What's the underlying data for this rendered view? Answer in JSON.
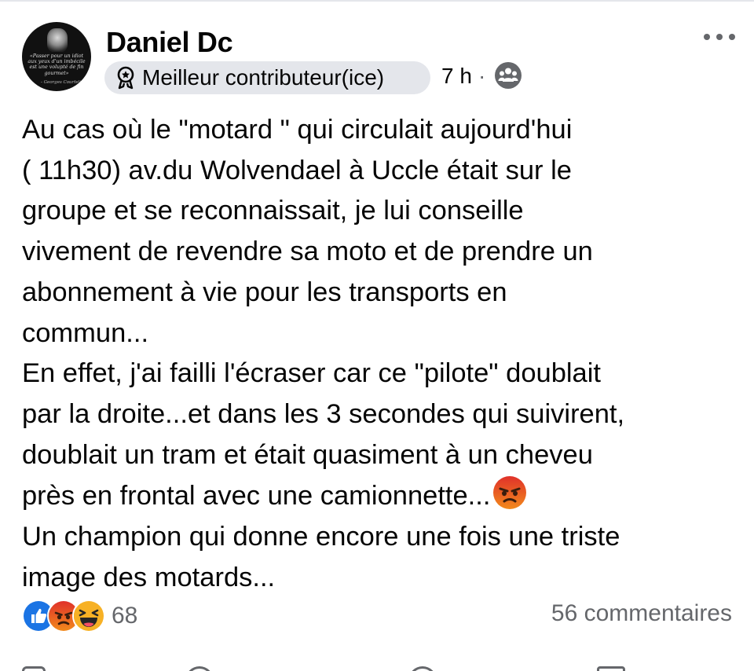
{
  "post": {
    "author": {
      "name": "Daniel Dc",
      "avatar_quote": "«Passer pour un idiot aux yeux d'un imbécile est une volupté de fin gourmet»",
      "avatar_attribution": "- Georges Courteline"
    },
    "badge": {
      "icon": "star-badge-icon",
      "label": "Meilleur contributeur(ice)"
    },
    "time": "7 h",
    "separator": "·",
    "audience_icon": "group-audience-icon",
    "more_icon": "more-options-icon",
    "body_lines": [
      "Au cas où le \"motard \" qui circulait aujourd'hui",
      "( 11h30) av.du Wolvendael à Uccle était sur le",
      "groupe et se reconnaissait, je lui conseille",
      "vivement de revendre sa moto et de prendre un",
      "abonnement à vie pour les transports en",
      "commun...",
      "En effet, j'ai failli l'écraser car ce \"pilote\" doublait",
      "par la droite...et dans les 3 secondes qui suivirent,",
      "doublait un tram et était quasiment à un cheveu",
      "près en frontal avec une camionnette...",
      "Un champion qui donne encore une fois une triste",
      "image des motards..."
    ],
    "inline_emoji": "angry-face-emoji",
    "reactions": {
      "icons": [
        "like-reaction-icon",
        "angry-reaction-icon",
        "haha-reaction-icon"
      ],
      "count": "68"
    },
    "comments": "56 commentaires"
  },
  "colors": {
    "text": "#050505",
    "secondary": "#65676b",
    "badge_bg": "#e4e6eb",
    "like_blue": "#1b74e4",
    "angry_orange": "#e9710f",
    "haha_yellow": "#f7b125"
  }
}
